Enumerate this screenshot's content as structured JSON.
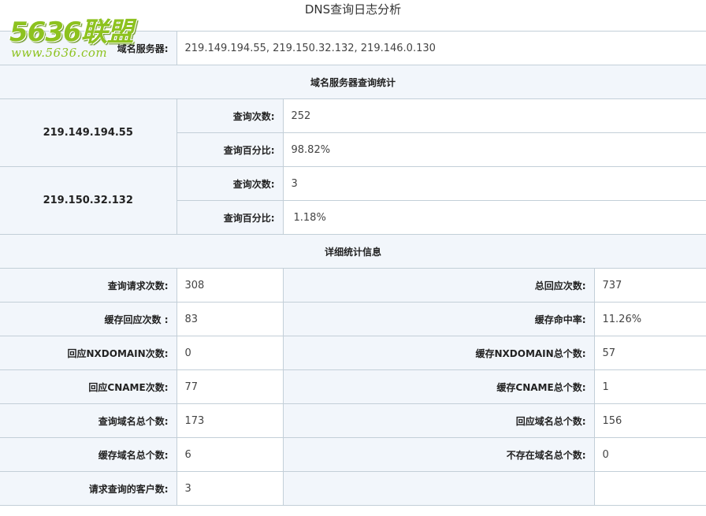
{
  "title": "DNS查询日志分析",
  "logo": {
    "main": "5636联盟",
    "sub": "www.5636.com"
  },
  "dns_servers": {
    "label": "域名服务器:",
    "value": "219.149.194.55, 219.150.32.132, 219.146.0.130"
  },
  "server_stats": {
    "heading": "域名服务器查询统计",
    "count_label": "查询次数:",
    "percent_label": "查询百分比:",
    "servers": [
      {
        "ip": "219.149.194.55",
        "count": "252",
        "percent": "98.82%"
      },
      {
        "ip": "219.150.32.132",
        "count": "3",
        "percent": "1.18%"
      }
    ]
  },
  "detail": {
    "heading": "详细统计信息",
    "rows": [
      {
        "l_label": "查询请求次数:",
        "l_value": "308",
        "r_label": "总回应次数:",
        "r_value": "737"
      },
      {
        "l_label": "缓存回应次数 :",
        "l_value": "83",
        "r_label": "缓存命中率:",
        "r_value": "11.26%"
      },
      {
        "l_label": "回应NXDOMAIN次数:",
        "l_value": "0",
        "r_label": "缓存NXDOMAIN总个数:",
        "r_value": "57"
      },
      {
        "l_label": "回应CNAME次数:",
        "l_value": "77",
        "r_label": "缓存CNAME总个数:",
        "r_value": "1"
      },
      {
        "l_label": "查询域名总个数:",
        "l_value": "173",
        "r_label": "回应域名总个数:",
        "r_value": "156"
      },
      {
        "l_label": "缓存域名总个数:",
        "l_value": "6",
        "r_label": "不存在域名总个数:",
        "r_value": "0"
      }
    ],
    "last_row": {
      "l_label": "请求查询的客户数:",
      "l_value": "3"
    }
  }
}
